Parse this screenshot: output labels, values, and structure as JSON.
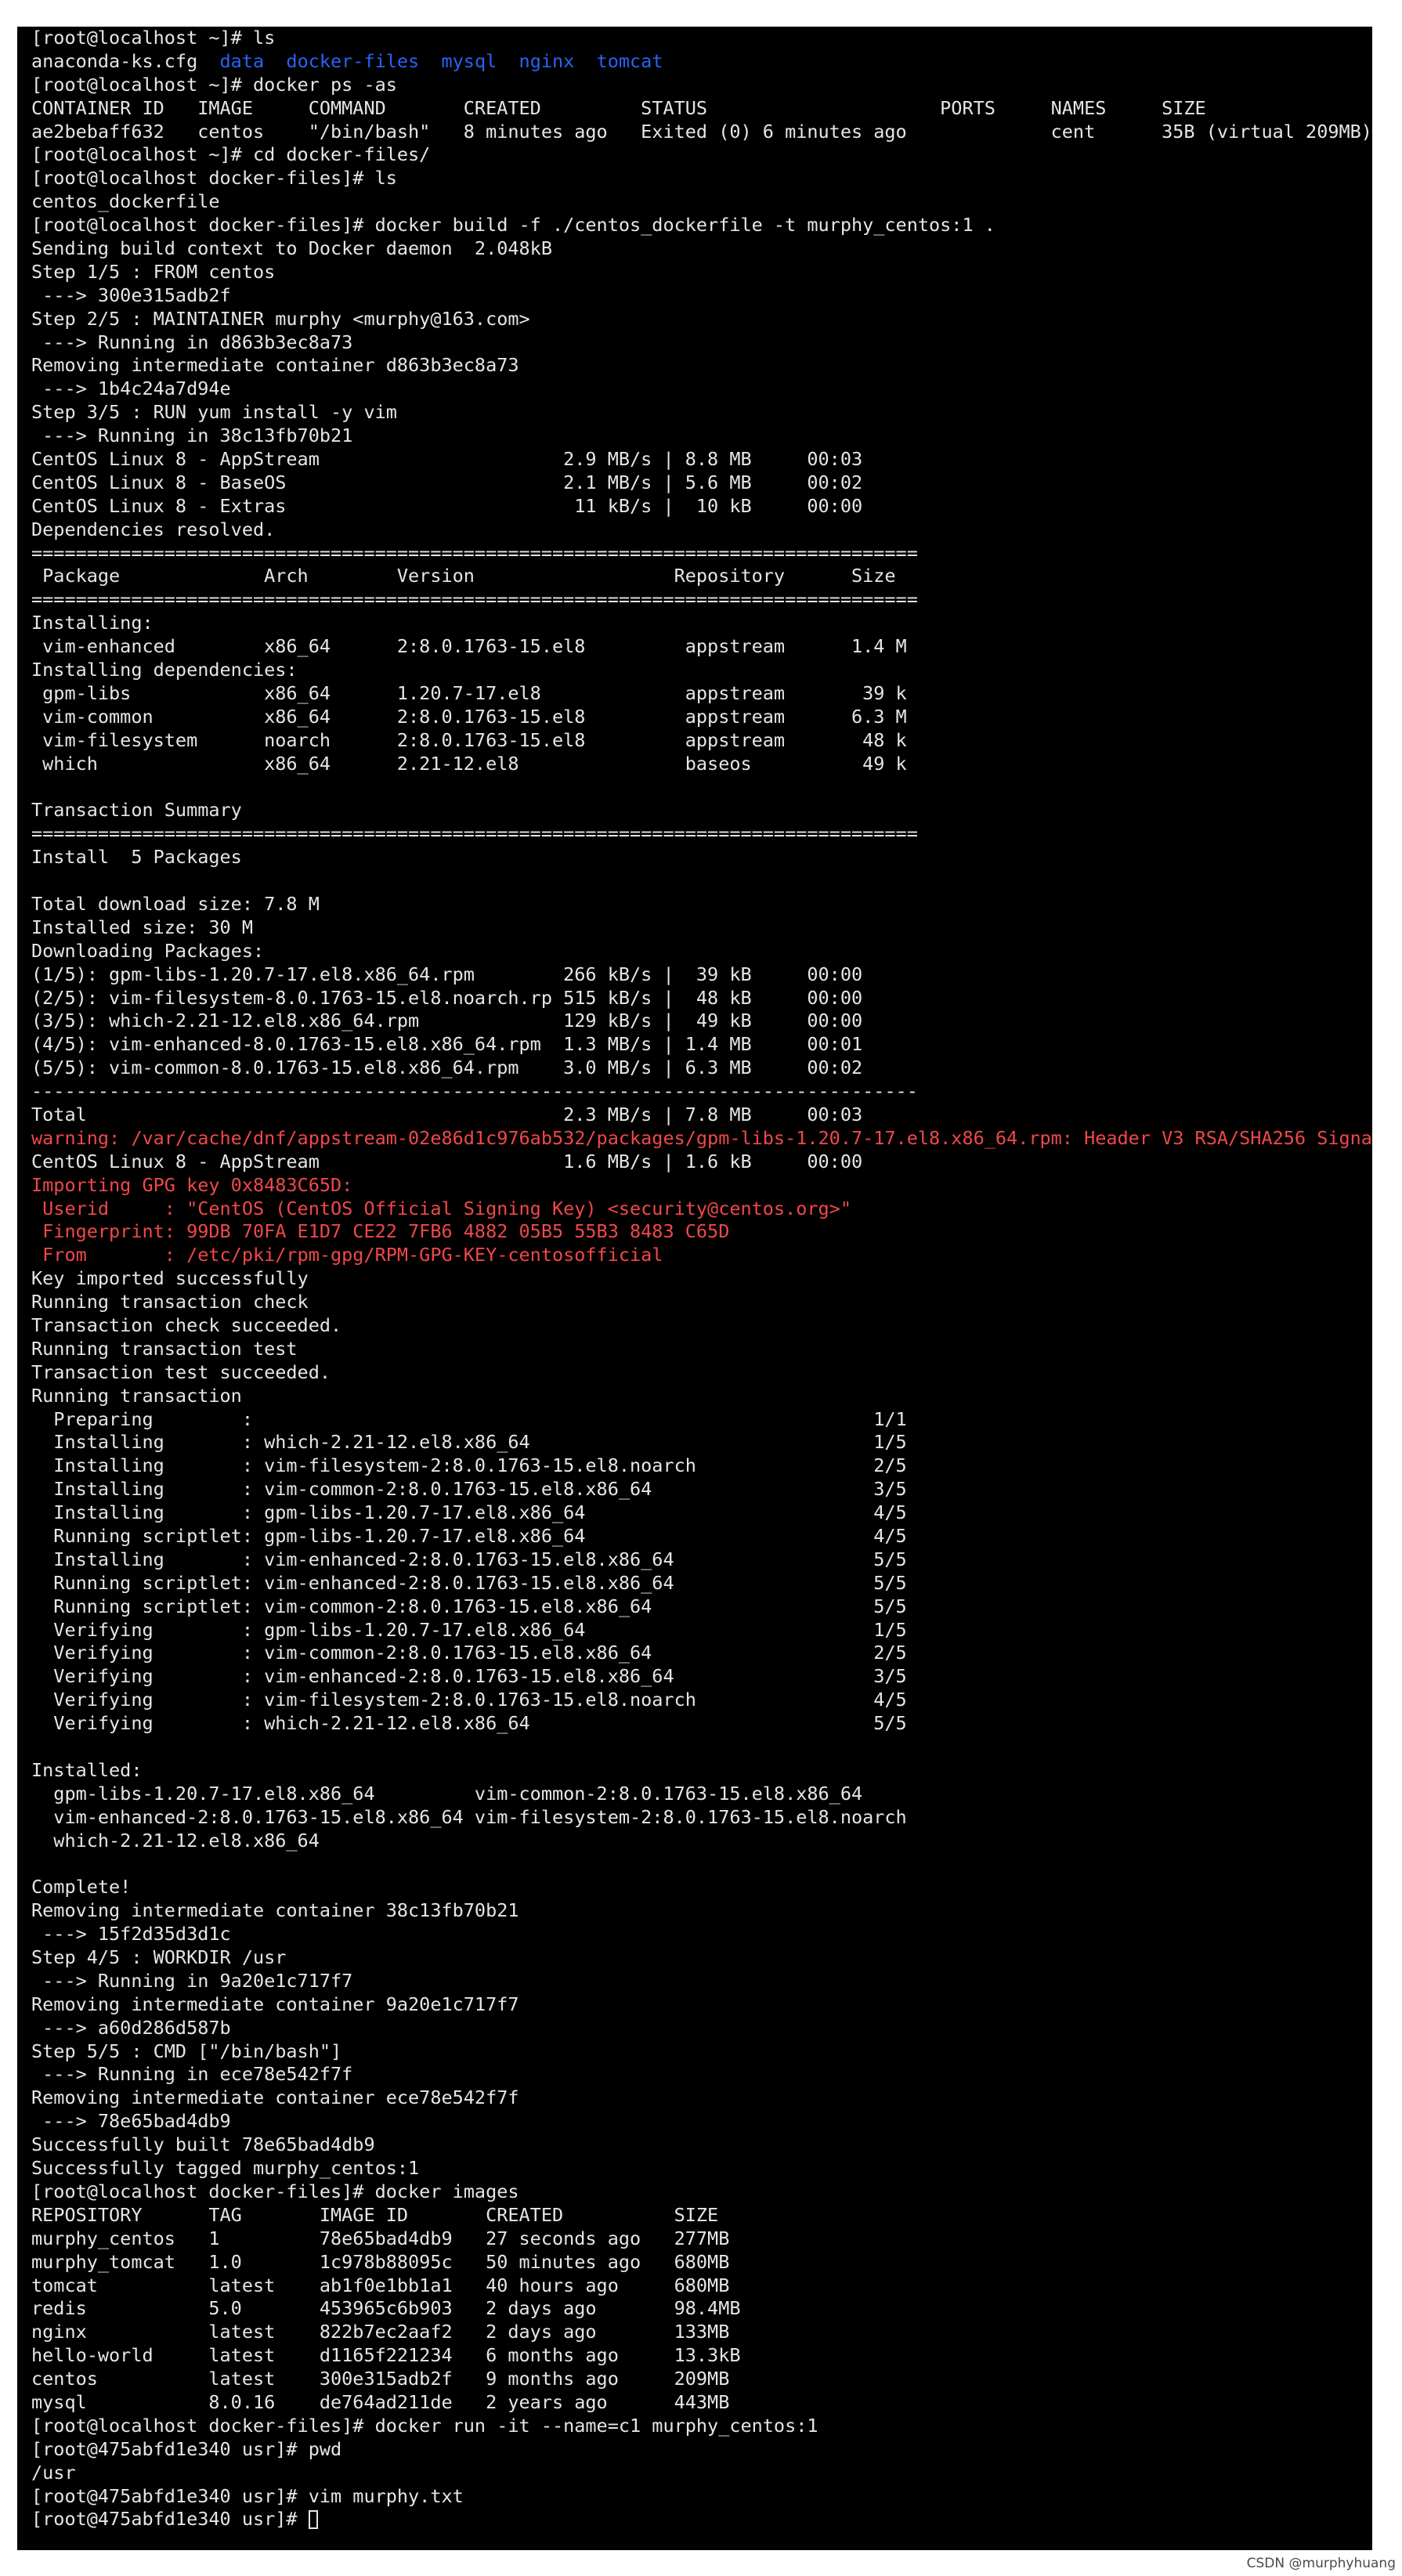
{
  "colors": {
    "background": "#000000",
    "text": "#e6e6e6",
    "directory_blue": "#2a62f5",
    "warning_red": "#f0484a",
    "page": "#ffffff"
  },
  "terminal": {
    "lines": [
      [
        {
          "text": "[root@localhost ~]# ls"
        }
      ],
      [
        {
          "text": "anaconda-ks.cfg  "
        },
        {
          "text": "data",
          "color": "blue"
        },
        {
          "text": "  "
        },
        {
          "text": "docker-files",
          "color": "blue"
        },
        {
          "text": "  "
        },
        {
          "text": "mysql",
          "color": "blue"
        },
        {
          "text": "  "
        },
        {
          "text": "nginx",
          "color": "blue"
        },
        {
          "text": "  "
        },
        {
          "text": "tomcat",
          "color": "blue"
        }
      ],
      [
        {
          "text": "[root@localhost ~]# docker ps -as"
        }
      ],
      [
        {
          "text": "CONTAINER ID   IMAGE     COMMAND       CREATED         STATUS                     PORTS     NAMES     SIZE"
        }
      ],
      [
        {
          "text": "ae2bebaff632   centos    \"/bin/bash\"   8 minutes ago   Exited (0) 6 minutes ago             cent      35B (virtual 209MB)"
        }
      ],
      [
        {
          "text": "[root@localhost ~]# cd docker-files/"
        }
      ],
      [
        {
          "text": "[root@localhost docker-files]# ls"
        }
      ],
      [
        {
          "text": "centos_dockerfile"
        }
      ],
      [
        {
          "text": "[root@localhost docker-files]# docker build -f ./centos_dockerfile -t murphy_centos:1 ."
        }
      ],
      [
        {
          "text": "Sending build context to Docker daemon  2.048kB"
        }
      ],
      [
        {
          "text": "Step 1/5 : FROM centos"
        }
      ],
      [
        {
          "text": " ---> 300e315adb2f"
        }
      ],
      [
        {
          "text": "Step 2/5 : MAINTAINER murphy <murphy@163.com>"
        }
      ],
      [
        {
          "text": " ---> Running in d863b3ec8a73"
        }
      ],
      [
        {
          "text": "Removing intermediate container d863b3ec8a73"
        }
      ],
      [
        {
          "text": " ---> 1b4c24a7d94e"
        }
      ],
      [
        {
          "text": "Step 3/5 : RUN yum install -y vim"
        }
      ],
      [
        {
          "text": " ---> Running in 38c13fb70b21"
        }
      ],
      [
        {
          "text": "CentOS Linux 8 - AppStream                      2.9 MB/s | 8.8 MB     00:03"
        }
      ],
      [
        {
          "text": "CentOS Linux 8 - BaseOS                         2.1 MB/s | 5.6 MB     00:02"
        }
      ],
      [
        {
          "text": "CentOS Linux 8 - Extras                          11 kB/s |  10 kB     00:00"
        }
      ],
      [
        {
          "text": "Dependencies resolved."
        }
      ],
      [
        {
          "text": "================================================================================"
        }
      ],
      [
        {
          "text": " Package             Arch        Version                  Repository      Size"
        }
      ],
      [
        {
          "text": "================================================================================"
        }
      ],
      [
        {
          "text": "Installing:"
        }
      ],
      [
        {
          "text": " vim-enhanced        x86_64      2:8.0.1763-15.el8         appstream      1.4 M"
        }
      ],
      [
        {
          "text": "Installing dependencies:"
        }
      ],
      [
        {
          "text": " gpm-libs            x86_64      1.20.7-17.el8             appstream       39 k"
        }
      ],
      [
        {
          "text": " vim-common          x86_64      2:8.0.1763-15.el8         appstream      6.3 M"
        }
      ],
      [
        {
          "text": " vim-filesystem      noarch      2:8.0.1763-15.el8         appstream       48 k"
        }
      ],
      [
        {
          "text": " which               x86_64      2.21-12.el8               baseos          49 k"
        }
      ],
      [
        {
          "text": ""
        }
      ],
      [
        {
          "text": "Transaction Summary"
        }
      ],
      [
        {
          "text": "================================================================================"
        }
      ],
      [
        {
          "text": "Install  5 Packages"
        }
      ],
      [
        {
          "text": ""
        }
      ],
      [
        {
          "text": "Total download size: 7.8 M"
        }
      ],
      [
        {
          "text": "Installed size: 30 M"
        }
      ],
      [
        {
          "text": "Downloading Packages:"
        }
      ],
      [
        {
          "text": "(1/5): gpm-libs-1.20.7-17.el8.x86_64.rpm        266 kB/s |  39 kB     00:00"
        }
      ],
      [
        {
          "text": "(2/5): vim-filesystem-8.0.1763-15.el8.noarch.rp 515 kB/s |  48 kB     00:00"
        }
      ],
      [
        {
          "text": "(3/5): which-2.21-12.el8.x86_64.rpm             129 kB/s |  49 kB     00:00"
        }
      ],
      [
        {
          "text": "(4/5): vim-enhanced-8.0.1763-15.el8.x86_64.rpm  1.3 MB/s | 1.4 MB     00:01"
        }
      ],
      [
        {
          "text": "(5/5): vim-common-8.0.1763-15.el8.x86_64.rpm    3.0 MB/s | 6.3 MB     00:02"
        }
      ],
      [
        {
          "text": "--------------------------------------------------------------------------------"
        }
      ],
      [
        {
          "text": "Total                                           2.3 MB/s | 7.8 MB     00:03"
        }
      ],
      [
        {
          "text": "warning: /var/cache/dnf/appstream-02e86d1c976ab532/packages/gpm-libs-1.20.7-17.el8.x86_64.rpm: Header V3 RSA/SHA256 Signat",
          "color": "red"
        }
      ],
      [
        {
          "text": "CentOS Linux 8 - AppStream                      1.6 MB/s | 1.6 kB     00:00"
        }
      ],
      [
        {
          "text": "Importing GPG key 0x8483C65D:",
          "color": "red"
        }
      ],
      [
        {
          "text": " Userid     : \"CentOS (CentOS Official Signing Key) <security@centos.org>\"",
          "color": "red"
        }
      ],
      [
        {
          "text": " Fingerprint: 99DB 70FA E1D7 CE22 7FB6 4882 05B5 55B3 8483 C65D",
          "color": "red"
        }
      ],
      [
        {
          "text": " From       : /etc/pki/rpm-gpg/RPM-GPG-KEY-centosofficial",
          "color": "red"
        }
      ],
      [
        {
          "text": "Key imported successfully"
        }
      ],
      [
        {
          "text": "Running transaction check"
        }
      ],
      [
        {
          "text": "Transaction check succeeded."
        }
      ],
      [
        {
          "text": "Running transaction test"
        }
      ],
      [
        {
          "text": "Transaction test succeeded."
        }
      ],
      [
        {
          "text": "Running transaction"
        }
      ],
      [
        {
          "text": "  Preparing        :                                                        1/1"
        }
      ],
      [
        {
          "text": "  Installing       : which-2.21-12.el8.x86_64                               1/5"
        }
      ],
      [
        {
          "text": "  Installing       : vim-filesystem-2:8.0.1763-15.el8.noarch                2/5"
        }
      ],
      [
        {
          "text": "  Installing       : vim-common-2:8.0.1763-15.el8.x86_64                    3/5"
        }
      ],
      [
        {
          "text": "  Installing       : gpm-libs-1.20.7-17.el8.x86_64                          4/5"
        }
      ],
      [
        {
          "text": "  Running scriptlet: gpm-libs-1.20.7-17.el8.x86_64                          4/5"
        }
      ],
      [
        {
          "text": "  Installing       : vim-enhanced-2:8.0.1763-15.el8.x86_64                  5/5"
        }
      ],
      [
        {
          "text": "  Running scriptlet: vim-enhanced-2:8.0.1763-15.el8.x86_64                  5/5"
        }
      ],
      [
        {
          "text": "  Running scriptlet: vim-common-2:8.0.1763-15.el8.x86_64                    5/5"
        }
      ],
      [
        {
          "text": "  Verifying        : gpm-libs-1.20.7-17.el8.x86_64                          1/5"
        }
      ],
      [
        {
          "text": "  Verifying        : vim-common-2:8.0.1763-15.el8.x86_64                    2/5"
        }
      ],
      [
        {
          "text": "  Verifying        : vim-enhanced-2:8.0.1763-15.el8.x86_64                  3/5"
        }
      ],
      [
        {
          "text": "  Verifying        : vim-filesystem-2:8.0.1763-15.el8.noarch                4/5"
        }
      ],
      [
        {
          "text": "  Verifying        : which-2.21-12.el8.x86_64                               5/5"
        }
      ],
      [
        {
          "text": ""
        }
      ],
      [
        {
          "text": "Installed:"
        }
      ],
      [
        {
          "text": "  gpm-libs-1.20.7-17.el8.x86_64         vim-common-2:8.0.1763-15.el8.x86_64"
        }
      ],
      [
        {
          "text": "  vim-enhanced-2:8.0.1763-15.el8.x86_64 vim-filesystem-2:8.0.1763-15.el8.noarch"
        }
      ],
      [
        {
          "text": "  which-2.21-12.el8.x86_64"
        }
      ],
      [
        {
          "text": ""
        }
      ],
      [
        {
          "text": "Complete!"
        }
      ],
      [
        {
          "text": "Removing intermediate container 38c13fb70b21"
        }
      ],
      [
        {
          "text": " ---> 15f2d35d3d1c"
        }
      ],
      [
        {
          "text": "Step 4/5 : WORKDIR /usr"
        }
      ],
      [
        {
          "text": " ---> Running in 9a20e1c717f7"
        }
      ],
      [
        {
          "text": "Removing intermediate container 9a20e1c717f7"
        }
      ],
      [
        {
          "text": " ---> a60d286d587b"
        }
      ],
      [
        {
          "text": "Step 5/5 : CMD [\"/bin/bash\"]"
        }
      ],
      [
        {
          "text": " ---> Running in ece78e542f7f"
        }
      ],
      [
        {
          "text": "Removing intermediate container ece78e542f7f"
        }
      ],
      [
        {
          "text": " ---> 78e65bad4db9"
        }
      ],
      [
        {
          "text": "Successfully built 78e65bad4db9"
        }
      ],
      [
        {
          "text": "Successfully tagged murphy_centos:1"
        }
      ],
      [
        {
          "text": "[root@localhost docker-files]# docker images"
        }
      ],
      [
        {
          "text": "REPOSITORY      TAG       IMAGE ID       CREATED          SIZE"
        }
      ],
      [
        {
          "text": "murphy_centos   1         78e65bad4db9   27 seconds ago   277MB"
        }
      ],
      [
        {
          "text": "murphy_tomcat   1.0       1c978b88095c   50 minutes ago   680MB"
        }
      ],
      [
        {
          "text": "tomcat          latest    ab1f0e1bb1a1   40 hours ago     680MB"
        }
      ],
      [
        {
          "text": "redis           5.0       453965c6b903   2 days ago       98.4MB"
        }
      ],
      [
        {
          "text": "nginx           latest    822b7ec2aaf2   2 days ago       133MB"
        }
      ],
      [
        {
          "text": "hello-world     latest    d1165f221234   6 months ago     13.3kB"
        }
      ],
      [
        {
          "text": "centos          latest    300e315adb2f   9 months ago     209MB"
        }
      ],
      [
        {
          "text": "mysql           8.0.16    de764ad211de   2 years ago      443MB"
        }
      ],
      [
        {
          "text": "[root@localhost docker-files]# docker run -it --name=c1 murphy_centos:1"
        }
      ],
      [
        {
          "text": "[root@475abfd1e340 usr]# pwd"
        }
      ],
      [
        {
          "text": "/usr"
        }
      ],
      [
        {
          "text": "[root@475abfd1e340 usr]# vim murphy.txt"
        }
      ],
      [
        {
          "text": "[root@475abfd1e340 usr]# "
        },
        {
          "cursor": true
        }
      ]
    ]
  },
  "watermark": "CSDN @murphyhuang"
}
